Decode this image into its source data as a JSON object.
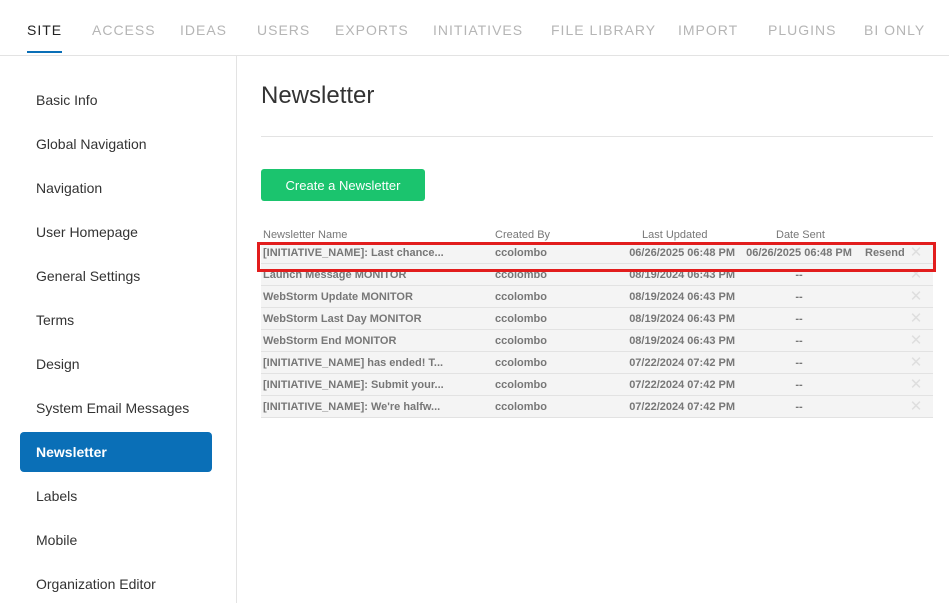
{
  "topnav": {
    "tabs": [
      "SITE",
      "ACCESS",
      "IDEAS",
      "USERS",
      "EXPORTS",
      "INITIATIVES",
      "FILE LIBRARY",
      "IMPORT",
      "PLUGINS",
      "BI ONLY"
    ]
  },
  "sidebar": {
    "items": [
      "Basic Info",
      "Global Navigation",
      "Navigation",
      "User Homepage",
      "General Settings",
      "Terms",
      "Design",
      "System Email Messages",
      "Newsletter",
      "Labels",
      "Mobile",
      "Organization Editor"
    ],
    "active": "Newsletter"
  },
  "main": {
    "title": "Newsletter",
    "create_button": "Create a Newsletter",
    "columns": [
      "Newsletter Name",
      "Created By",
      "Last Updated",
      "Date Sent"
    ],
    "rows": [
      {
        "name": "[INITIATIVE_NAME]: Last chance...",
        "created_by": "ccolombo",
        "last_updated": "06/26/2025 06:48 PM",
        "date_sent": "06/26/2025 06:48 PM",
        "action": "Resend",
        "delete": "✕"
      },
      {
        "name": "Launch Message MONITOR",
        "created_by": "ccolombo",
        "last_updated": "08/19/2024 06:43 PM",
        "date_sent": "--",
        "action": "",
        "delete": "✕"
      },
      {
        "name": "WebStorm Update MONITOR",
        "created_by": "ccolombo",
        "last_updated": "08/19/2024 06:43 PM",
        "date_sent": "--",
        "action": "",
        "delete": "✕"
      },
      {
        "name": "WebStorm Last Day MONITOR",
        "created_by": "ccolombo",
        "last_updated": "08/19/2024 06:43 PM",
        "date_sent": "--",
        "action": "",
        "delete": "✕"
      },
      {
        "name": "WebStorm End MONITOR",
        "created_by": "ccolombo",
        "last_updated": "08/19/2024 06:43 PM",
        "date_sent": "--",
        "action": "",
        "delete": "✕"
      },
      {
        "name": "[INITIATIVE_NAME] has ended! T...",
        "created_by": "ccolombo",
        "last_updated": "07/22/2024 07:42 PM",
        "date_sent": "--",
        "action": "",
        "delete": "✕"
      },
      {
        "name": "[INITIATIVE_NAME]: Submit your...",
        "created_by": "ccolombo",
        "last_updated": "07/22/2024 07:42 PM",
        "date_sent": "--",
        "action": "",
        "delete": "✕"
      },
      {
        "name": "[INITIATIVE_NAME]: We're halfw...",
        "created_by": "ccolombo",
        "last_updated": "07/22/2024 07:42 PM",
        "date_sent": "--",
        "action": "",
        "delete": "✕"
      }
    ]
  },
  "colors": {
    "accent": "#0a6fb7",
    "create_button": "#1bc46e",
    "highlight": "#e21d1d"
  }
}
